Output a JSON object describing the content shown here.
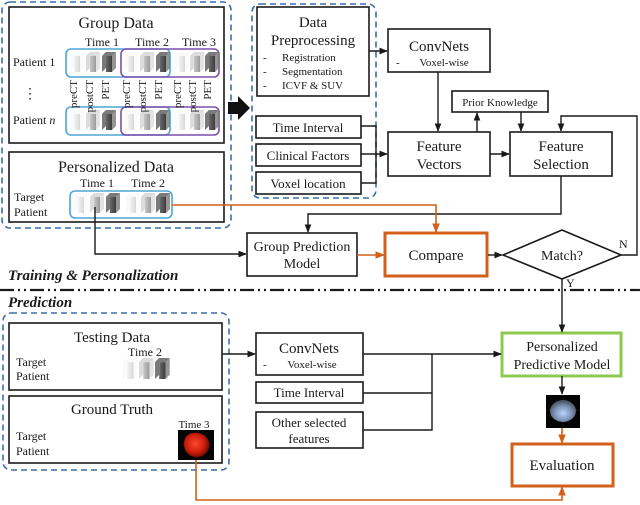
{
  "colors": {
    "dashed_group": "#3a6fa8",
    "time1_group": "#4fa6d6",
    "time_shift_group": "#7d4fb0",
    "compare_eval": "#d2601a",
    "personalized_model": "#8cc94e",
    "line": "#1a1a1a"
  },
  "group_data": {
    "title": "Group Data",
    "times": [
      "Time 1",
      "Time 2",
      "Time 3"
    ],
    "patient_1": "Patient 1",
    "ellipsis": "⋮",
    "patient_n_prefix": "Patient ",
    "patient_n_var": "n",
    "modalities": [
      "preCT",
      "postCT",
      "PET"
    ]
  },
  "personalized_data": {
    "title": "Personalized Data",
    "times": [
      "Time 1",
      "Time 2"
    ],
    "patient_line1": "Target",
    "patient_line2": "Patient"
  },
  "preprocessing": {
    "title_line1": "Data",
    "title_line2": "Preprocessing",
    "items": [
      "Registration",
      "Segmentation",
      "ICVF & SUV"
    ],
    "bullet": "-"
  },
  "inputs": {
    "time_interval": "Time Interval",
    "clinical_factors": "Clinical Factors",
    "voxel_location": "Voxel location"
  },
  "convnets_top": {
    "title": "ConvNets",
    "bullet": "-",
    "sub": "Voxel-wise"
  },
  "prior_knowledge": "Prior Knowledge",
  "feature_vectors": {
    "line1": "Feature",
    "line2": "Vectors"
  },
  "feature_selection": {
    "line1": "Feature",
    "line2": "Selection"
  },
  "group_prediction": {
    "line1": "Group Prediction",
    "line2": "Model"
  },
  "compare": "Compare",
  "match": {
    "label": "Match?",
    "no": "N",
    "yes": "Y"
  },
  "sections": {
    "training": "Training & Personalization",
    "prediction": "Prediction"
  },
  "testing_data": {
    "title": "Testing Data",
    "time": "Time 2",
    "patient_line1": "Target",
    "patient_line2": "Patient"
  },
  "ground_truth": {
    "title": "Ground Truth",
    "time": "Time 3",
    "patient_line1": "Target",
    "patient_line2": "Patient"
  },
  "convnets_bottom": {
    "title": "ConvNets",
    "bullet": "-",
    "sub": "Voxel-wise"
  },
  "time_interval_bottom": "Time Interval",
  "other_features": {
    "line1": "Other selected",
    "line2": "features"
  },
  "personalized_model": {
    "line1": "Personalized",
    "line2": "Predictive Model"
  },
  "evaluation": "Evaluation"
}
